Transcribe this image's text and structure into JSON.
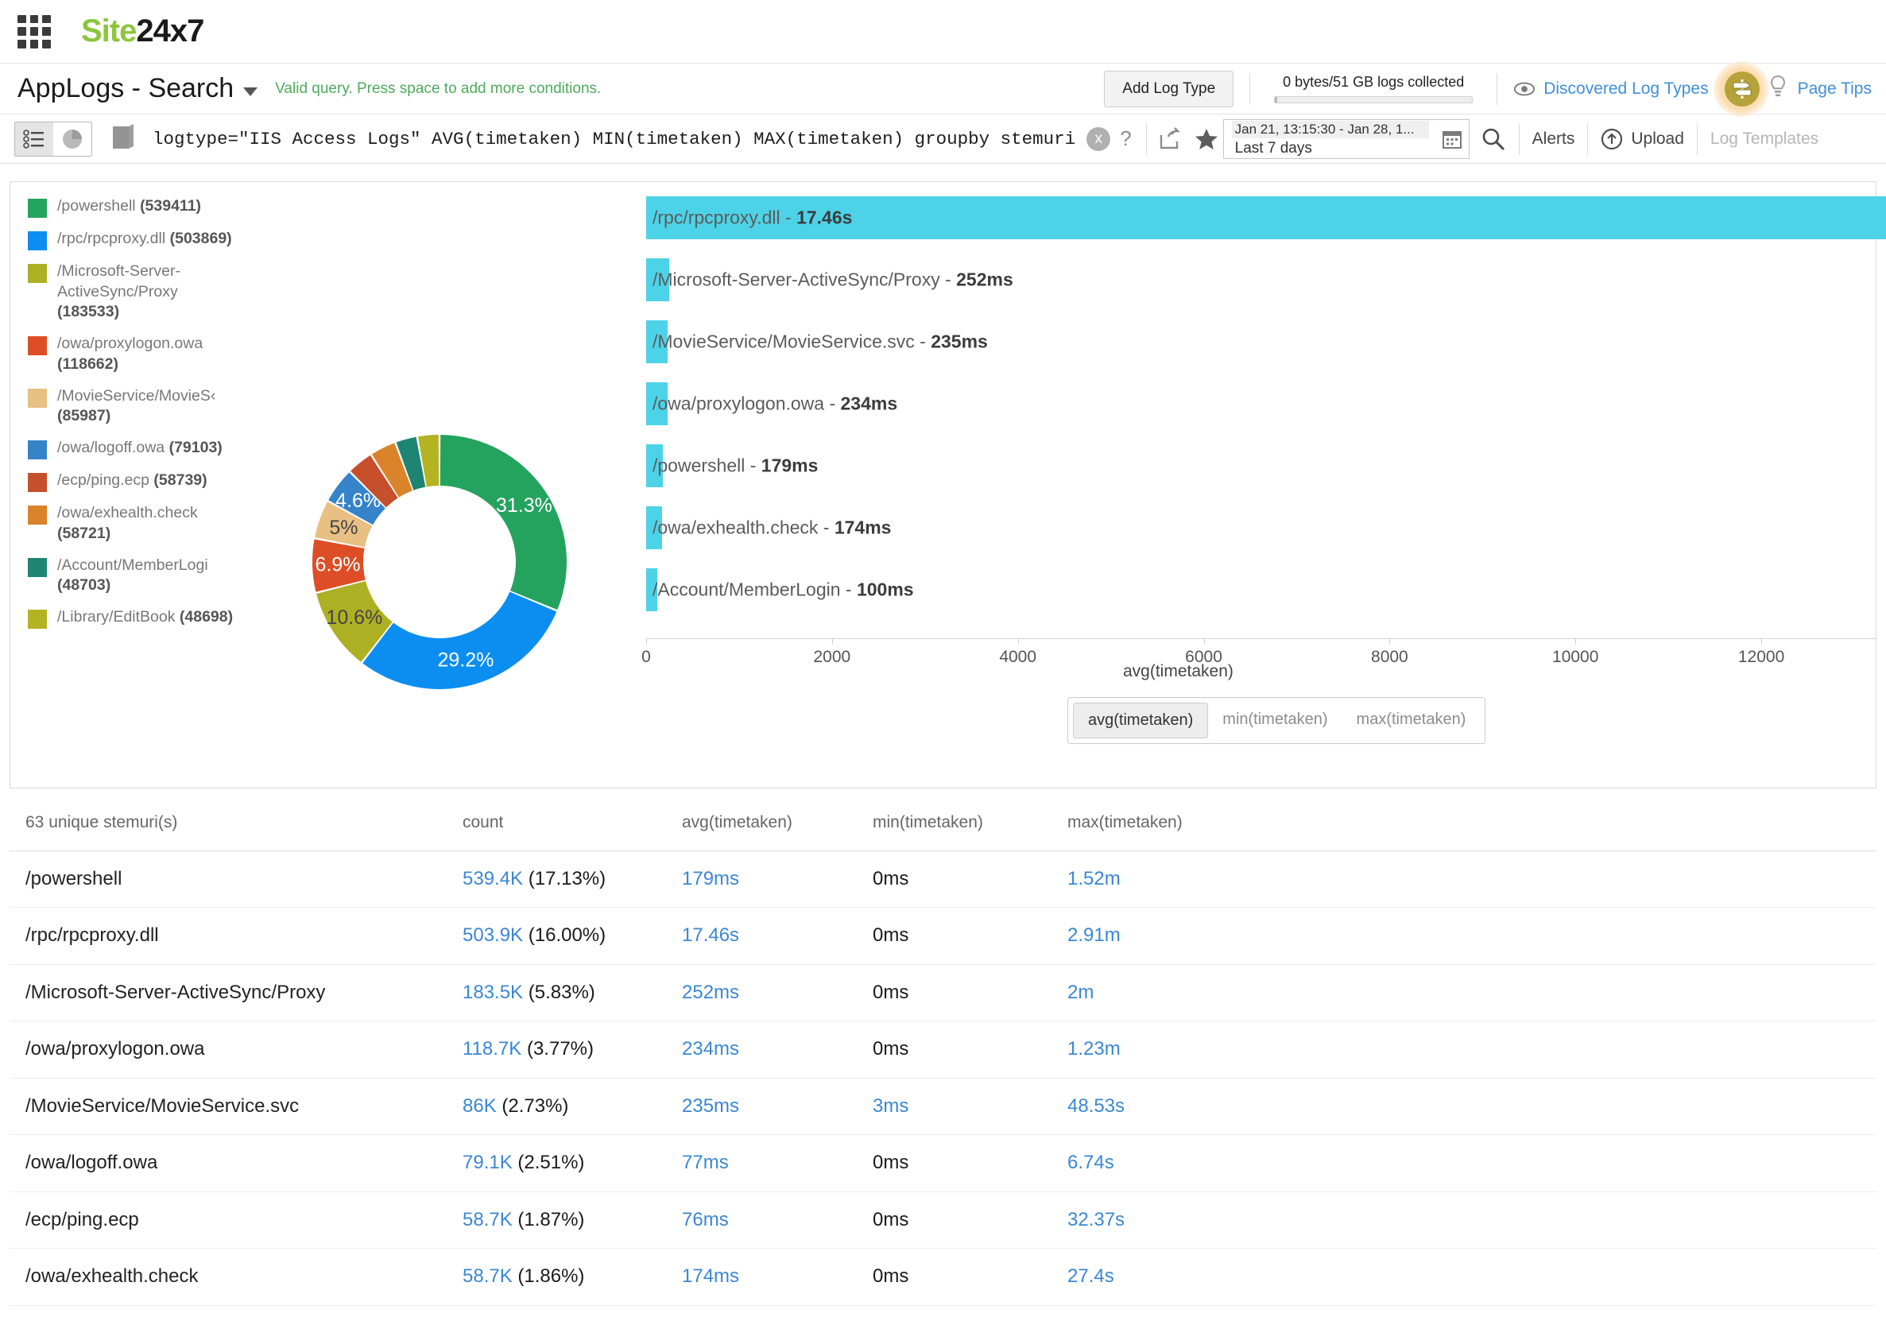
{
  "brand": {
    "part1": "Site",
    "part2": "24x7"
  },
  "header": {
    "page_title": "AppLogs - Search",
    "validity_message": "Valid query. Press space to add more conditions.",
    "add_log_type_label": "Add Log Type",
    "collected_label": "0 bytes/51 GB logs collected",
    "discovered_log_types_label": "Discovered Log Types",
    "page_tips_label": "Page Tips"
  },
  "querybar": {
    "query": "logtype=\"IIS Access Logs\" AVG(timetaken) MIN(timetaken) MAX(timetaken) groupby stemuri",
    "clear_label": "x",
    "help_label": "?",
    "date_range_top": "Jan 21, 13:15:30 - Jan 28, 1...",
    "date_range_bottom": "Last 7 days",
    "alerts_label": "Alerts",
    "upload_label": "Upload",
    "log_templates_label": "Log Templates"
  },
  "chart_data": {
    "type": "pie",
    "title": "",
    "legend_position": "left",
    "categories": [
      "/powershell",
      "/rpc/rpcproxy.dll",
      "/Microsoft-Server-ActiveSync/Proxy",
      "/owa/proxylogon.owa",
      "/MovieService/MovieSe",
      "/owa/logoff.owa",
      "/ecp/ping.ecp",
      "/owa/exhealth.check",
      "/Account/MemberLogi",
      "/Library/EditBook"
    ],
    "values": [
      539411,
      503869,
      183533,
      118662,
      85987,
      79103,
      58739,
      58721,
      48703,
      48698
    ],
    "percent_labels": [
      "31.3%",
      "29.2%",
      "10.6%",
      "6.9%",
      "5%",
      "4.6%",
      "",
      "",
      "",
      ""
    ],
    "colors": [
      "#24a35f",
      "#0b8ef0",
      "#aeb023",
      "#dd4e26",
      "#e8c084",
      "#3583c8",
      "#c6502c",
      "#d9842a",
      "#1f8573",
      "#b4b322"
    ],
    "legend_entries": [
      {
        "label": "/powershell",
        "count": "(539411)"
      },
      {
        "label": "/rpc/rpcproxy.dll",
        "count": "(503869)"
      },
      {
        "label": "/Microsoft-Server-ActiveSync/Proxy",
        "count": "(183533)"
      },
      {
        "label": "/owa/proxylogon.owa",
        "count": "(118662)"
      },
      {
        "label": "/MovieService/MovieS‹",
        "count": "(85987)"
      },
      {
        "label": "/owa/logoff.owa",
        "count": "(79103)"
      },
      {
        "label": "/ecp/ping.ecp",
        "count": "(58739)"
      },
      {
        "label": "/owa/exhealth.check",
        "count": "(58721)"
      },
      {
        "label": "/Account/MemberLogi",
        "count": "(48703)"
      },
      {
        "label": "/Library/EditBook",
        "count": "(48698)"
      }
    ]
  },
  "chart_data_bar": {
    "type": "bar",
    "orientation": "horizontal",
    "xlabel": "avg(timetaken)",
    "xlim": [
      0,
      13000
    ],
    "xticks": [
      0,
      2000,
      4000,
      6000,
      8000,
      10000,
      12000
    ],
    "xtick_labels": [
      "0",
      "2000",
      "4000",
      "6000",
      "8000",
      "10000",
      "12000"
    ],
    "bar_color": "#4cd3e8",
    "categories": [
      "/rpc/rpcproxy.dll",
      "/Microsoft-Server-ActiveSync/Proxy",
      "/MovieService/MovieService.svc",
      "/owa/proxylogon.owa",
      "/powershell",
      "/owa/exhealth.check",
      "/Account/MemberLogin"
    ],
    "values": [
      17460,
      252,
      235,
      234,
      179,
      174,
      100
    ],
    "value_labels": [
      "17.46s",
      "252ms",
      "235ms",
      "234ms",
      "179ms",
      "174ms",
      "100ms"
    ],
    "bars": [
      {
        "name": "/rpc/rpcproxy.dll",
        "value_label": "17.46s",
        "value": 17460
      },
      {
        "name": "/Microsoft-Server-ActiveSync/Proxy",
        "value_label": "252ms",
        "value": 252
      },
      {
        "name": "/MovieService/MovieService.svc",
        "value_label": "235ms",
        "value": 235
      },
      {
        "name": "/owa/proxylogon.owa",
        "value_label": "234ms",
        "value": 234
      },
      {
        "name": "/powershell",
        "value_label": "179ms",
        "value": 179
      },
      {
        "name": "/owa/exhealth.check",
        "value_label": "174ms",
        "value": 174
      },
      {
        "name": "/Account/MemberLogin",
        "value_label": "100ms",
        "value": 100
      }
    ]
  },
  "metric_tabs": {
    "selected": "avg(timetaken)",
    "options": [
      "avg(timetaken)",
      "min(timetaken)",
      "max(timetaken)"
    ]
  },
  "table": {
    "headers": [
      "63 unique stemuri(s)",
      "count",
      "avg(timetaken)",
      "min(timetaken)",
      "max(timetaken)"
    ],
    "rows": [
      {
        "stemuri": "/powershell",
        "count": "539.4K",
        "count_pct": "(17.13%)",
        "avg": "179ms",
        "min": "0ms",
        "max": "1.52m",
        "min_is_link": false
      },
      {
        "stemuri": "/rpc/rpcproxy.dll",
        "count": "503.9K",
        "count_pct": "(16.00%)",
        "avg": "17.46s",
        "min": "0ms",
        "max": "2.91m",
        "min_is_link": false
      },
      {
        "stemuri": "/Microsoft-Server-ActiveSync/Proxy",
        "count": "183.5K",
        "count_pct": "(5.83%)",
        "avg": "252ms",
        "min": "0ms",
        "max": "2m",
        "min_is_link": false
      },
      {
        "stemuri": "/owa/proxylogon.owa",
        "count": "118.7K",
        "count_pct": "(3.77%)",
        "avg": "234ms",
        "min": "0ms",
        "max": "1.23m",
        "min_is_link": false
      },
      {
        "stemuri": "/MovieService/MovieService.svc",
        "count": "86K",
        "count_pct": "(2.73%)",
        "avg": "235ms",
        "min": "3ms",
        "max": "48.53s",
        "min_is_link": true
      },
      {
        "stemuri": "/owa/logoff.owa",
        "count": "79.1K",
        "count_pct": "(2.51%)",
        "avg": "77ms",
        "min": "0ms",
        "max": "6.74s",
        "min_is_link": false
      },
      {
        "stemuri": "/ecp/ping.ecp",
        "count": "58.7K",
        "count_pct": "(1.87%)",
        "avg": "76ms",
        "min": "0ms",
        "max": "32.37s",
        "min_is_link": false
      },
      {
        "stemuri": "/owa/exhealth.check",
        "count": "58.7K",
        "count_pct": "(1.86%)",
        "avg": "174ms",
        "min": "0ms",
        "max": "27.4s",
        "min_is_link": false
      }
    ]
  },
  "icons": {
    "app_grid": "app-grid-icon",
    "eye": "eye-icon",
    "bulb": "bulb-icon",
    "calendar": "calendar-icon",
    "search": "search-icon",
    "upload": "upload-icon",
    "share": "share-icon",
    "star": "star-icon",
    "book": "book-icon"
  }
}
